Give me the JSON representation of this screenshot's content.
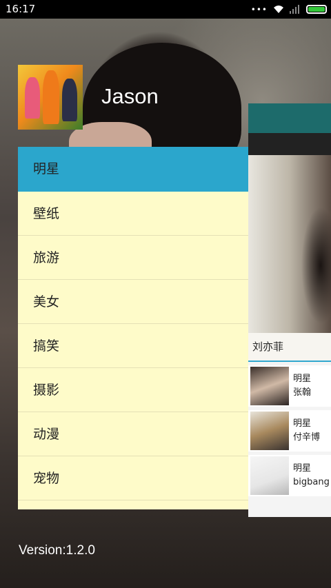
{
  "status_bar": {
    "time": "16:17",
    "dots": "•••"
  },
  "drawer": {
    "username": "Jason",
    "menu": [
      {
        "label": "明星",
        "active": true
      },
      {
        "label": "壁纸"
      },
      {
        "label": "旅游"
      },
      {
        "label": "美女"
      },
      {
        "label": "搞笑"
      },
      {
        "label": "摄影"
      },
      {
        "label": "动漫"
      },
      {
        "label": "宠物"
      }
    ],
    "version": "Version:1.2.0"
  },
  "main": {
    "caption": "刘亦菲",
    "items": [
      {
        "category": "明星",
        "name": "张翰"
      },
      {
        "category": "明星",
        "name": "付辛博"
      },
      {
        "category": "明星",
        "name": "bigbang"
      }
    ]
  },
  "colors": {
    "accent": "#2ba6cc",
    "menu_bg": "#fefbc9",
    "toolbar": "#1d6b6b",
    "battery": "#34c73a"
  }
}
